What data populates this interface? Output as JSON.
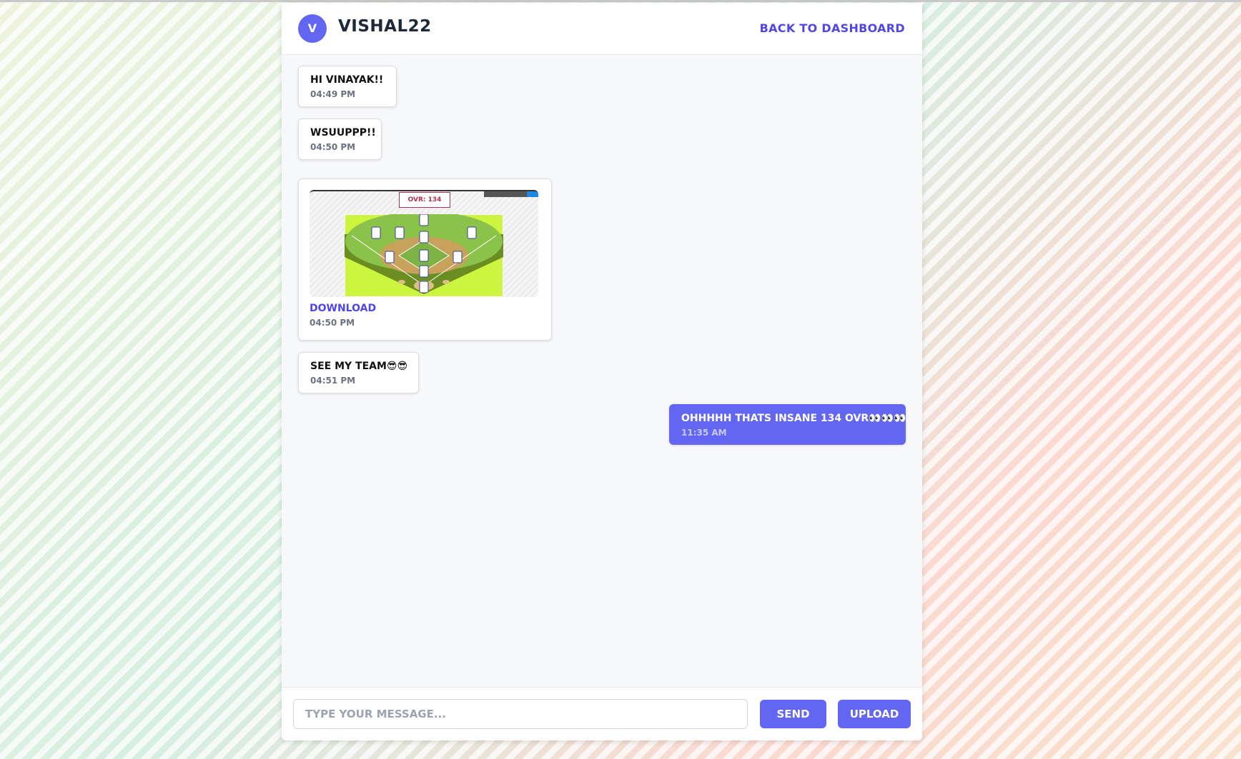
{
  "header": {
    "avatar_letter": "V",
    "username": "VISHAL22",
    "back_label": "BACK TO DASHBOARD"
  },
  "messages": [
    {
      "text": "HI VINAYAK!!",
      "time": "04:49 PM",
      "sender": "other"
    },
    {
      "text": "WSUUPPP!!",
      "time": "04:50 PM",
      "sender": "other"
    },
    {
      "image_label": "OVR: 134",
      "download_label": "DOWNLOAD",
      "time": "04:50 PM",
      "sender": "other"
    },
    {
      "text": "SEE MY TEAM😎😎",
      "time": "04:51 PM",
      "sender": "other"
    },
    {
      "text": "OHHHHH THATS INSANE 134 OVR👀👀👀",
      "time": "11:35 AM",
      "sender": "me"
    }
  ],
  "composer": {
    "placeholder": "TYPE YOUR MESSAGE...",
    "value": "",
    "send_label": "SEND",
    "upload_label": "UPLOAD"
  },
  "colors": {
    "accent": "#6366f1",
    "link": "#4f46e5"
  }
}
